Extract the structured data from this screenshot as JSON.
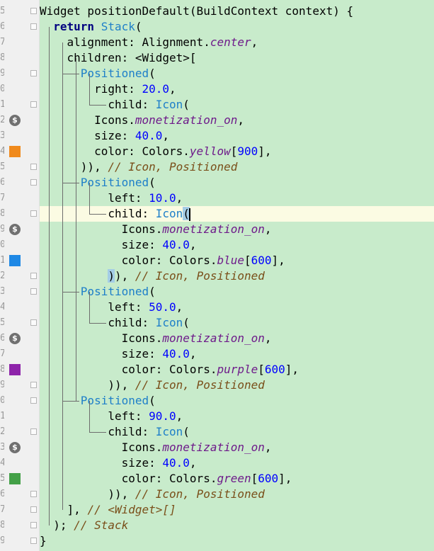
{
  "function_name": "positionDefault",
  "gutter": {
    "line_numbers": [
      "5",
      "6",
      "7",
      "8",
      "9",
      "0",
      "1",
      "2",
      "3",
      "4",
      "5",
      "6",
      "7",
      "8",
      "9",
      "0",
      "1",
      "2",
      "3",
      "4",
      "5",
      "6",
      "7",
      "8",
      "9",
      "0",
      "1",
      "2",
      "3",
      "4",
      "5",
      "6",
      "7",
      "8",
      "9"
    ],
    "icons": [
      {
        "type": "coin",
        "line": 7,
        "name": "monetization-on-icon"
      },
      {
        "type": "swatch",
        "line": 9,
        "color": "#f08a1c",
        "name": "yellow-color-swatch"
      },
      {
        "type": "coin",
        "line": 14,
        "name": "monetization-on-icon"
      },
      {
        "type": "swatch",
        "line": 16,
        "color": "#1e88e5",
        "name": "blue-color-swatch"
      },
      {
        "type": "coin",
        "line": 21,
        "name": "monetization-on-icon"
      },
      {
        "type": "swatch",
        "line": 23,
        "color": "#8e24aa",
        "name": "purple-color-swatch"
      },
      {
        "type": "coin",
        "line": 28,
        "name": "monetization-on-icon"
      },
      {
        "type": "swatch",
        "line": 30,
        "color": "#43a047",
        "name": "green-color-swatch"
      }
    ]
  },
  "editor": {
    "current_line": 13,
    "code": [
      {
        "indent": 0,
        "tokens": [
          [
            "Widget positionDefault(BuildContext context) {",
            ""
          ]
        ]
      },
      {
        "indent": 2,
        "tokens": [
          [
            "return",
            "kw"
          ],
          [
            " ",
            ""
          ],
          [
            "Stack",
            "cls"
          ],
          [
            "(",
            ""
          ]
        ]
      },
      {
        "indent": 4,
        "tokens": [
          [
            "alignment: Alignment.",
            ""
          ],
          [
            "center",
            "ital"
          ],
          [
            ",",
            ""
          ]
        ]
      },
      {
        "indent": 4,
        "tokens": [
          [
            "children: <Widget>[",
            ""
          ]
        ]
      },
      {
        "indent": 6,
        "tokens": [
          [
            "Positioned",
            "cls"
          ],
          [
            "(",
            ""
          ]
        ]
      },
      {
        "indent": 8,
        "tokens": [
          [
            "right: ",
            ""
          ],
          [
            "20.0",
            "num"
          ],
          [
            ",",
            ""
          ]
        ]
      },
      {
        "indent": 10,
        "tokens": [
          [
            "child: ",
            ""
          ],
          [
            "Icon",
            "cls"
          ],
          [
            "(",
            ""
          ]
        ]
      },
      {
        "indent": 8,
        "tokens": [
          [
            "Icons.",
            ""
          ],
          [
            "monetization_on",
            "ital"
          ],
          [
            ",",
            ""
          ]
        ]
      },
      {
        "indent": 8,
        "tokens": [
          [
            "size: ",
            ""
          ],
          [
            "40.0",
            "num"
          ],
          [
            ",",
            ""
          ]
        ]
      },
      {
        "indent": 8,
        "tokens": [
          [
            "color: Colors.",
            ""
          ],
          [
            "yellow",
            "ital"
          ],
          [
            "[",
            ""
          ],
          [
            "900",
            "num"
          ],
          [
            "],",
            ""
          ]
        ]
      },
      {
        "indent": 6,
        "tokens": [
          [
            ")), ",
            ""
          ],
          [
            "// Icon, Positioned",
            "cm"
          ]
        ]
      },
      {
        "indent": 6,
        "tokens": [
          [
            "Positioned",
            "cls"
          ],
          [
            "(",
            ""
          ]
        ]
      },
      {
        "indent": 10,
        "tokens": [
          [
            "left: ",
            ""
          ],
          [
            "10.0",
            "num"
          ],
          [
            ",",
            ""
          ]
        ]
      },
      {
        "indent": 10,
        "tokens": [
          [
            "child: ",
            ""
          ],
          [
            "Icon",
            "cls"
          ],
          [
            "(",
            "brk"
          ],
          [
            "",
            "cursor"
          ]
        ]
      },
      {
        "indent": 12,
        "tokens": [
          [
            "Icons.",
            ""
          ],
          [
            "monetization_on",
            "ital"
          ],
          [
            ",",
            ""
          ]
        ]
      },
      {
        "indent": 12,
        "tokens": [
          [
            "size: ",
            ""
          ],
          [
            "40.0",
            "num"
          ],
          [
            ",",
            ""
          ]
        ]
      },
      {
        "indent": 12,
        "tokens": [
          [
            "color: Colors.",
            ""
          ],
          [
            "blue",
            "ital"
          ],
          [
            "[",
            ""
          ],
          [
            "600",
            "num"
          ],
          [
            "],",
            ""
          ]
        ]
      },
      {
        "indent": 10,
        "tokens": [
          [
            ")",
            "brk"
          ],
          [
            "), ",
            ""
          ],
          [
            "// Icon, Positioned",
            "cm"
          ]
        ]
      },
      {
        "indent": 6,
        "tokens": [
          [
            "Positioned",
            "cls"
          ],
          [
            "(",
            ""
          ]
        ]
      },
      {
        "indent": 10,
        "tokens": [
          [
            "left: ",
            ""
          ],
          [
            "50.0",
            "num"
          ],
          [
            ",",
            ""
          ]
        ]
      },
      {
        "indent": 10,
        "tokens": [
          [
            "child: ",
            ""
          ],
          [
            "Icon",
            "cls"
          ],
          [
            "(",
            ""
          ]
        ]
      },
      {
        "indent": 12,
        "tokens": [
          [
            "Icons.",
            ""
          ],
          [
            "monetization_on",
            "ital"
          ],
          [
            ",",
            ""
          ]
        ]
      },
      {
        "indent": 12,
        "tokens": [
          [
            "size: ",
            ""
          ],
          [
            "40.0",
            "num"
          ],
          [
            ",",
            ""
          ]
        ]
      },
      {
        "indent": 12,
        "tokens": [
          [
            "color: Colors.",
            ""
          ],
          [
            "purple",
            "ital"
          ],
          [
            "[",
            ""
          ],
          [
            "600",
            "num"
          ],
          [
            "],",
            ""
          ]
        ]
      },
      {
        "indent": 10,
        "tokens": [
          [
            ")), ",
            ""
          ],
          [
            "// Icon, Positioned",
            "cm"
          ]
        ]
      },
      {
        "indent": 6,
        "tokens": [
          [
            "Positioned",
            "cls"
          ],
          [
            "(",
            ""
          ]
        ]
      },
      {
        "indent": 10,
        "tokens": [
          [
            "left: ",
            ""
          ],
          [
            "90.0",
            "num"
          ],
          [
            ",",
            ""
          ]
        ]
      },
      {
        "indent": 10,
        "tokens": [
          [
            "child: ",
            ""
          ],
          [
            "Icon",
            "cls"
          ],
          [
            "(",
            ""
          ]
        ]
      },
      {
        "indent": 12,
        "tokens": [
          [
            "Icons.",
            ""
          ],
          [
            "monetization_on",
            "ital"
          ],
          [
            ",",
            ""
          ]
        ]
      },
      {
        "indent": 12,
        "tokens": [
          [
            "size: ",
            ""
          ],
          [
            "40.0",
            "num"
          ],
          [
            ",",
            ""
          ]
        ]
      },
      {
        "indent": 12,
        "tokens": [
          [
            "color: Colors.",
            ""
          ],
          [
            "green",
            "ital"
          ],
          [
            "[",
            ""
          ],
          [
            "600",
            "num"
          ],
          [
            "],",
            ""
          ]
        ]
      },
      {
        "indent": 10,
        "tokens": [
          [
            ")), ",
            ""
          ],
          [
            "// Icon, Positioned",
            "cm"
          ]
        ]
      },
      {
        "indent": 4,
        "tokens": [
          [
            "], ",
            ""
          ],
          [
            "// <Widget>[]",
            "cm"
          ]
        ]
      },
      {
        "indent": 2,
        "tokens": [
          [
            "); ",
            ""
          ],
          [
            "// Stack",
            "cm"
          ]
        ]
      },
      {
        "indent": 0,
        "tokens": [
          [
            "}",
            ""
          ]
        ]
      }
    ]
  }
}
